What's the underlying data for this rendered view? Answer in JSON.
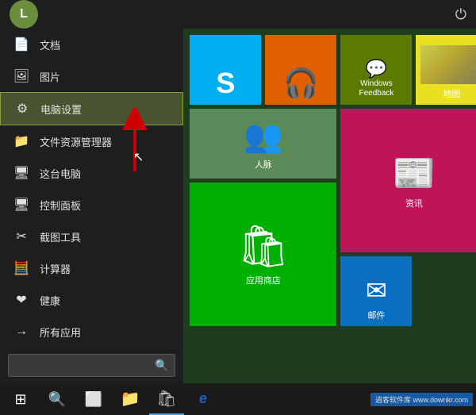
{
  "topbar": {
    "user_letter": "L",
    "power_symbol": "⏻"
  },
  "menu": {
    "items": [
      {
        "id": "documents",
        "label": "文档",
        "icon": "📄"
      },
      {
        "id": "pictures",
        "label": "图片",
        "icon": "🖼"
      },
      {
        "id": "pc-settings",
        "label": "电脑设置",
        "icon": "⚙",
        "active": true
      },
      {
        "id": "file-explorer",
        "label": "文件资源管理器",
        "icon": "📁"
      },
      {
        "id": "this-pc",
        "label": "这台电脑",
        "icon": "🖥"
      },
      {
        "id": "control-panel",
        "label": "控制面板",
        "icon": "🖥"
      },
      {
        "id": "snipping",
        "label": "截图工具",
        "icon": "✂"
      },
      {
        "id": "calculator",
        "label": "计算器",
        "icon": "🧮"
      },
      {
        "id": "health",
        "label": "健康",
        "icon": "❤"
      }
    ],
    "all_apps": "所有应用",
    "all_apps_icon": "→",
    "search_placeholder": ""
  },
  "tiles": [
    {
      "id": "skype",
      "label": "",
      "icon": "S",
      "color": "#00aff0"
    },
    {
      "id": "music",
      "label": "",
      "icon": "🎧",
      "color": "#e06000"
    },
    {
      "id": "feedback",
      "label": "Windows\nFeedback",
      "color": "#5a7a00"
    },
    {
      "id": "map",
      "label": "地图",
      "color": "#d4c000"
    },
    {
      "id": "people",
      "label": "人脉",
      "color": "#5a8a5a"
    },
    {
      "id": "news",
      "label": "资讯",
      "color": "#c0145a"
    },
    {
      "id": "store",
      "label": "应用商店",
      "color": "#00b000"
    },
    {
      "id": "mail",
      "label": "邮件",
      "color": "#0a6fc0"
    }
  ],
  "taskbar": {
    "start_icon": "⊞",
    "search_icon": "🔍",
    "task_icon": "⬜",
    "file_icon": "📄",
    "store_icon": "🛍",
    "ie_icon": "e",
    "watermark": "逍客软件库 www.downkr.com"
  }
}
